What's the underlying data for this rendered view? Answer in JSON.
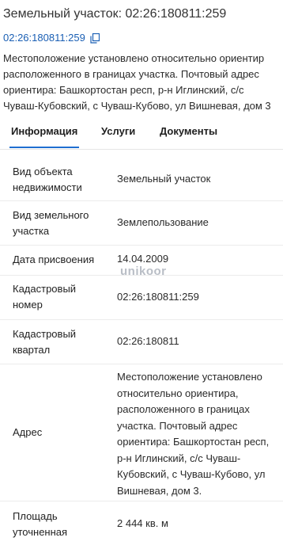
{
  "page": {
    "title": "Земельный участок: 02:26:180811:259",
    "cadastral_number": "02:26:180811:259",
    "location_lines": [
      "Местоположение установлено относительно ориентир",
      "расположенного в границах участка. Почтовый адрес",
      "ориентира: Башкортостан респ, р-н Иглинский, с/с",
      "Чуваш-Кубовский, с Чуваш-Кубово, ул Вишневая, дом 3"
    ]
  },
  "tabs": [
    {
      "label": "Информация",
      "active": true
    },
    {
      "label": "Услуги",
      "active": false
    },
    {
      "label": "Документы",
      "active": false
    }
  ],
  "info": [
    {
      "label": "Вид объекта недвижимости",
      "value": "Земельный участок"
    },
    {
      "label": "Вид земельного участка",
      "value": "Землепользование"
    },
    {
      "label": "Дата присвоения",
      "value": "14.04.2009"
    },
    {
      "label": "Кадастровый номер",
      "value": "02:26:180811:259"
    },
    {
      "label": "Кадастровый квартал",
      "value": "02:26:180811"
    },
    {
      "label": "Адрес",
      "value": "Местоположение установлено относительно ориентира, расположенного в границах участка. Почтовый адрес ориентира: Башкортостан респ, р-н Иглинский, с/с Чуваш-Кубовский, с Чуваш-Кубово, ул Вишневая, дом 3."
    },
    {
      "label": "Площадь уточненная",
      "value": "2 444 кв. м"
    }
  ],
  "watermark": "unikoor",
  "icons": {
    "copy": "copy-icon"
  },
  "colors": {
    "link": "#1a5fb4",
    "tab_underline": "#1f6fd1",
    "divider": "#ececec"
  }
}
